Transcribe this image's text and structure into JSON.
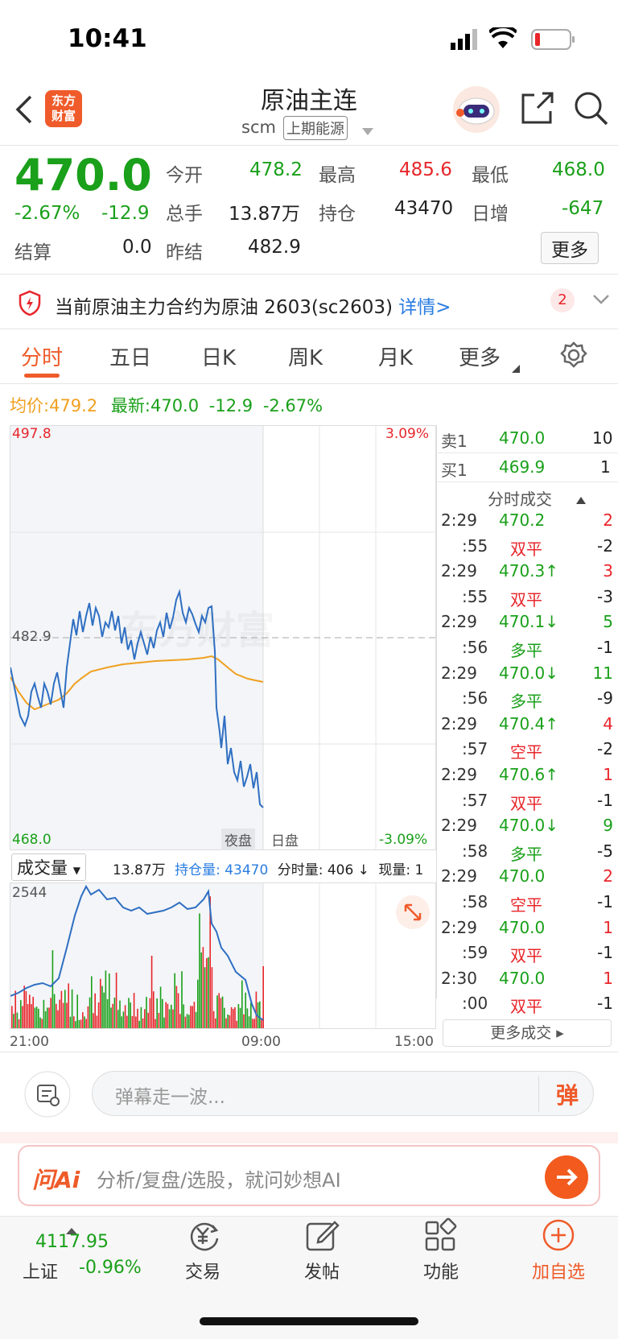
{
  "status": {
    "time": "10:41"
  },
  "header": {
    "title": "原油主连",
    "code": "scm",
    "exchange": "上期能源",
    "logo_text_1": "东方",
    "logo_text_2": "财富"
  },
  "quote": {
    "price": "470.0",
    "change_pct": "-2.67%",
    "change": "-12.9",
    "open_label": "今开",
    "open": "478.2",
    "high_label": "最高",
    "high": "485.6",
    "low_label": "最低",
    "low": "468.0",
    "vol_label": "总手",
    "vol": "13.87万",
    "oi_label": "持仓",
    "oi": "43470",
    "daily_inc_label": "日增",
    "daily_inc": "-647",
    "settle_label": "结算",
    "settle": "0.0",
    "prev_settle_label": "昨结",
    "prev_settle": "482.9",
    "more_button": "更多"
  },
  "notice": {
    "text": "当前原油主力合约为原油 2603(sc2603)",
    "link": "详情>",
    "badge": "2"
  },
  "tabs": [
    "分时",
    "五日",
    "日K",
    "周K",
    "月K",
    "更多"
  ],
  "legend": {
    "avg_label": "均价:",
    "avg": "479.2",
    "latest_label": "最新:",
    "latest": "470.0",
    "change": "-12.9",
    "pct": "-2.67%"
  },
  "chart_labels": {
    "ymax": "497.8",
    "ymid": "482.9",
    "ymin": "468.0",
    "pct_max": "3.09%",
    "pct_min": "-3.09%",
    "night": "夜盘",
    "day": "日盘",
    "x_start": "21:00",
    "x_mid": "09:00",
    "x_end": "15:00"
  },
  "volume_bar": {
    "selector": "成交量",
    "total": "13.87万",
    "oi": "持仓量: 43470",
    "tick_vol": "分时量: 406 ↓",
    "now_vol": "现量: 1",
    "vmax": "2544"
  },
  "orderbook": {
    "sell_label": "卖1",
    "sell_price": "470.0",
    "sell_qty": "10",
    "buy_label": "买1",
    "buy_price": "469.9",
    "buy_qty": "1"
  },
  "tick_trades": {
    "header": "分时成交",
    "rows": [
      {
        "t": "2:29",
        "v": "470.2",
        "q": "2"
      },
      {
        "t": ":55",
        "v": "双平",
        "q": "-2"
      },
      {
        "t": "2:29",
        "v": "470.3↑",
        "q": "3"
      },
      {
        "t": ":55",
        "v": "双平",
        "q": "-3"
      },
      {
        "t": "2:29",
        "v": "470.1↓",
        "q": "5"
      },
      {
        "t": ":56",
        "v": "多平",
        "q": "-1"
      },
      {
        "t": "2:29",
        "v": "470.0↓",
        "q": "11"
      },
      {
        "t": ":56",
        "v": "多平",
        "q": "-9"
      },
      {
        "t": "2:29",
        "v": "470.4↑",
        "q": "4"
      },
      {
        "t": ":57",
        "v": "空平",
        "q": "-2"
      },
      {
        "t": "2:29",
        "v": "470.6↑",
        "q": "1"
      },
      {
        "t": ":57",
        "v": "双平",
        "q": "-1"
      },
      {
        "t": "2:29",
        "v": "470.0↓",
        "q": "9"
      },
      {
        "t": ":58",
        "v": "多平",
        "q": "-5"
      },
      {
        "t": "2:29",
        "v": "470.0",
        "q": "2"
      },
      {
        "t": ":58",
        "v": "空平",
        "q": "-1"
      },
      {
        "t": "2:29",
        "v": "470.0",
        "q": "1"
      },
      {
        "t": ":59",
        "v": "双平",
        "q": "-1"
      },
      {
        "t": "2:30",
        "v": "470.0",
        "q": "1"
      },
      {
        "t": ":00",
        "v": "双平",
        "q": "-1"
      }
    ],
    "more": "更多成交 ▸"
  },
  "comment": {
    "placeholder": "弹幕走一波...",
    "danmu": "弹"
  },
  "ai": {
    "brand": "问Ai",
    "prompt": "分析/复盘/选股，就问妙想AI"
  },
  "bottom": {
    "index_value": "4117.95",
    "index_name": "上证",
    "index_pct": "-0.96%",
    "trade": "交易",
    "post": "发帖",
    "func": "功能",
    "add": "加自选"
  },
  "colors": {
    "up": "#e8262b",
    "down": "#1aa01a",
    "accent": "#ef5b2a",
    "price_line": "#2f6fc2",
    "avg_line": "#f0a020"
  }
}
